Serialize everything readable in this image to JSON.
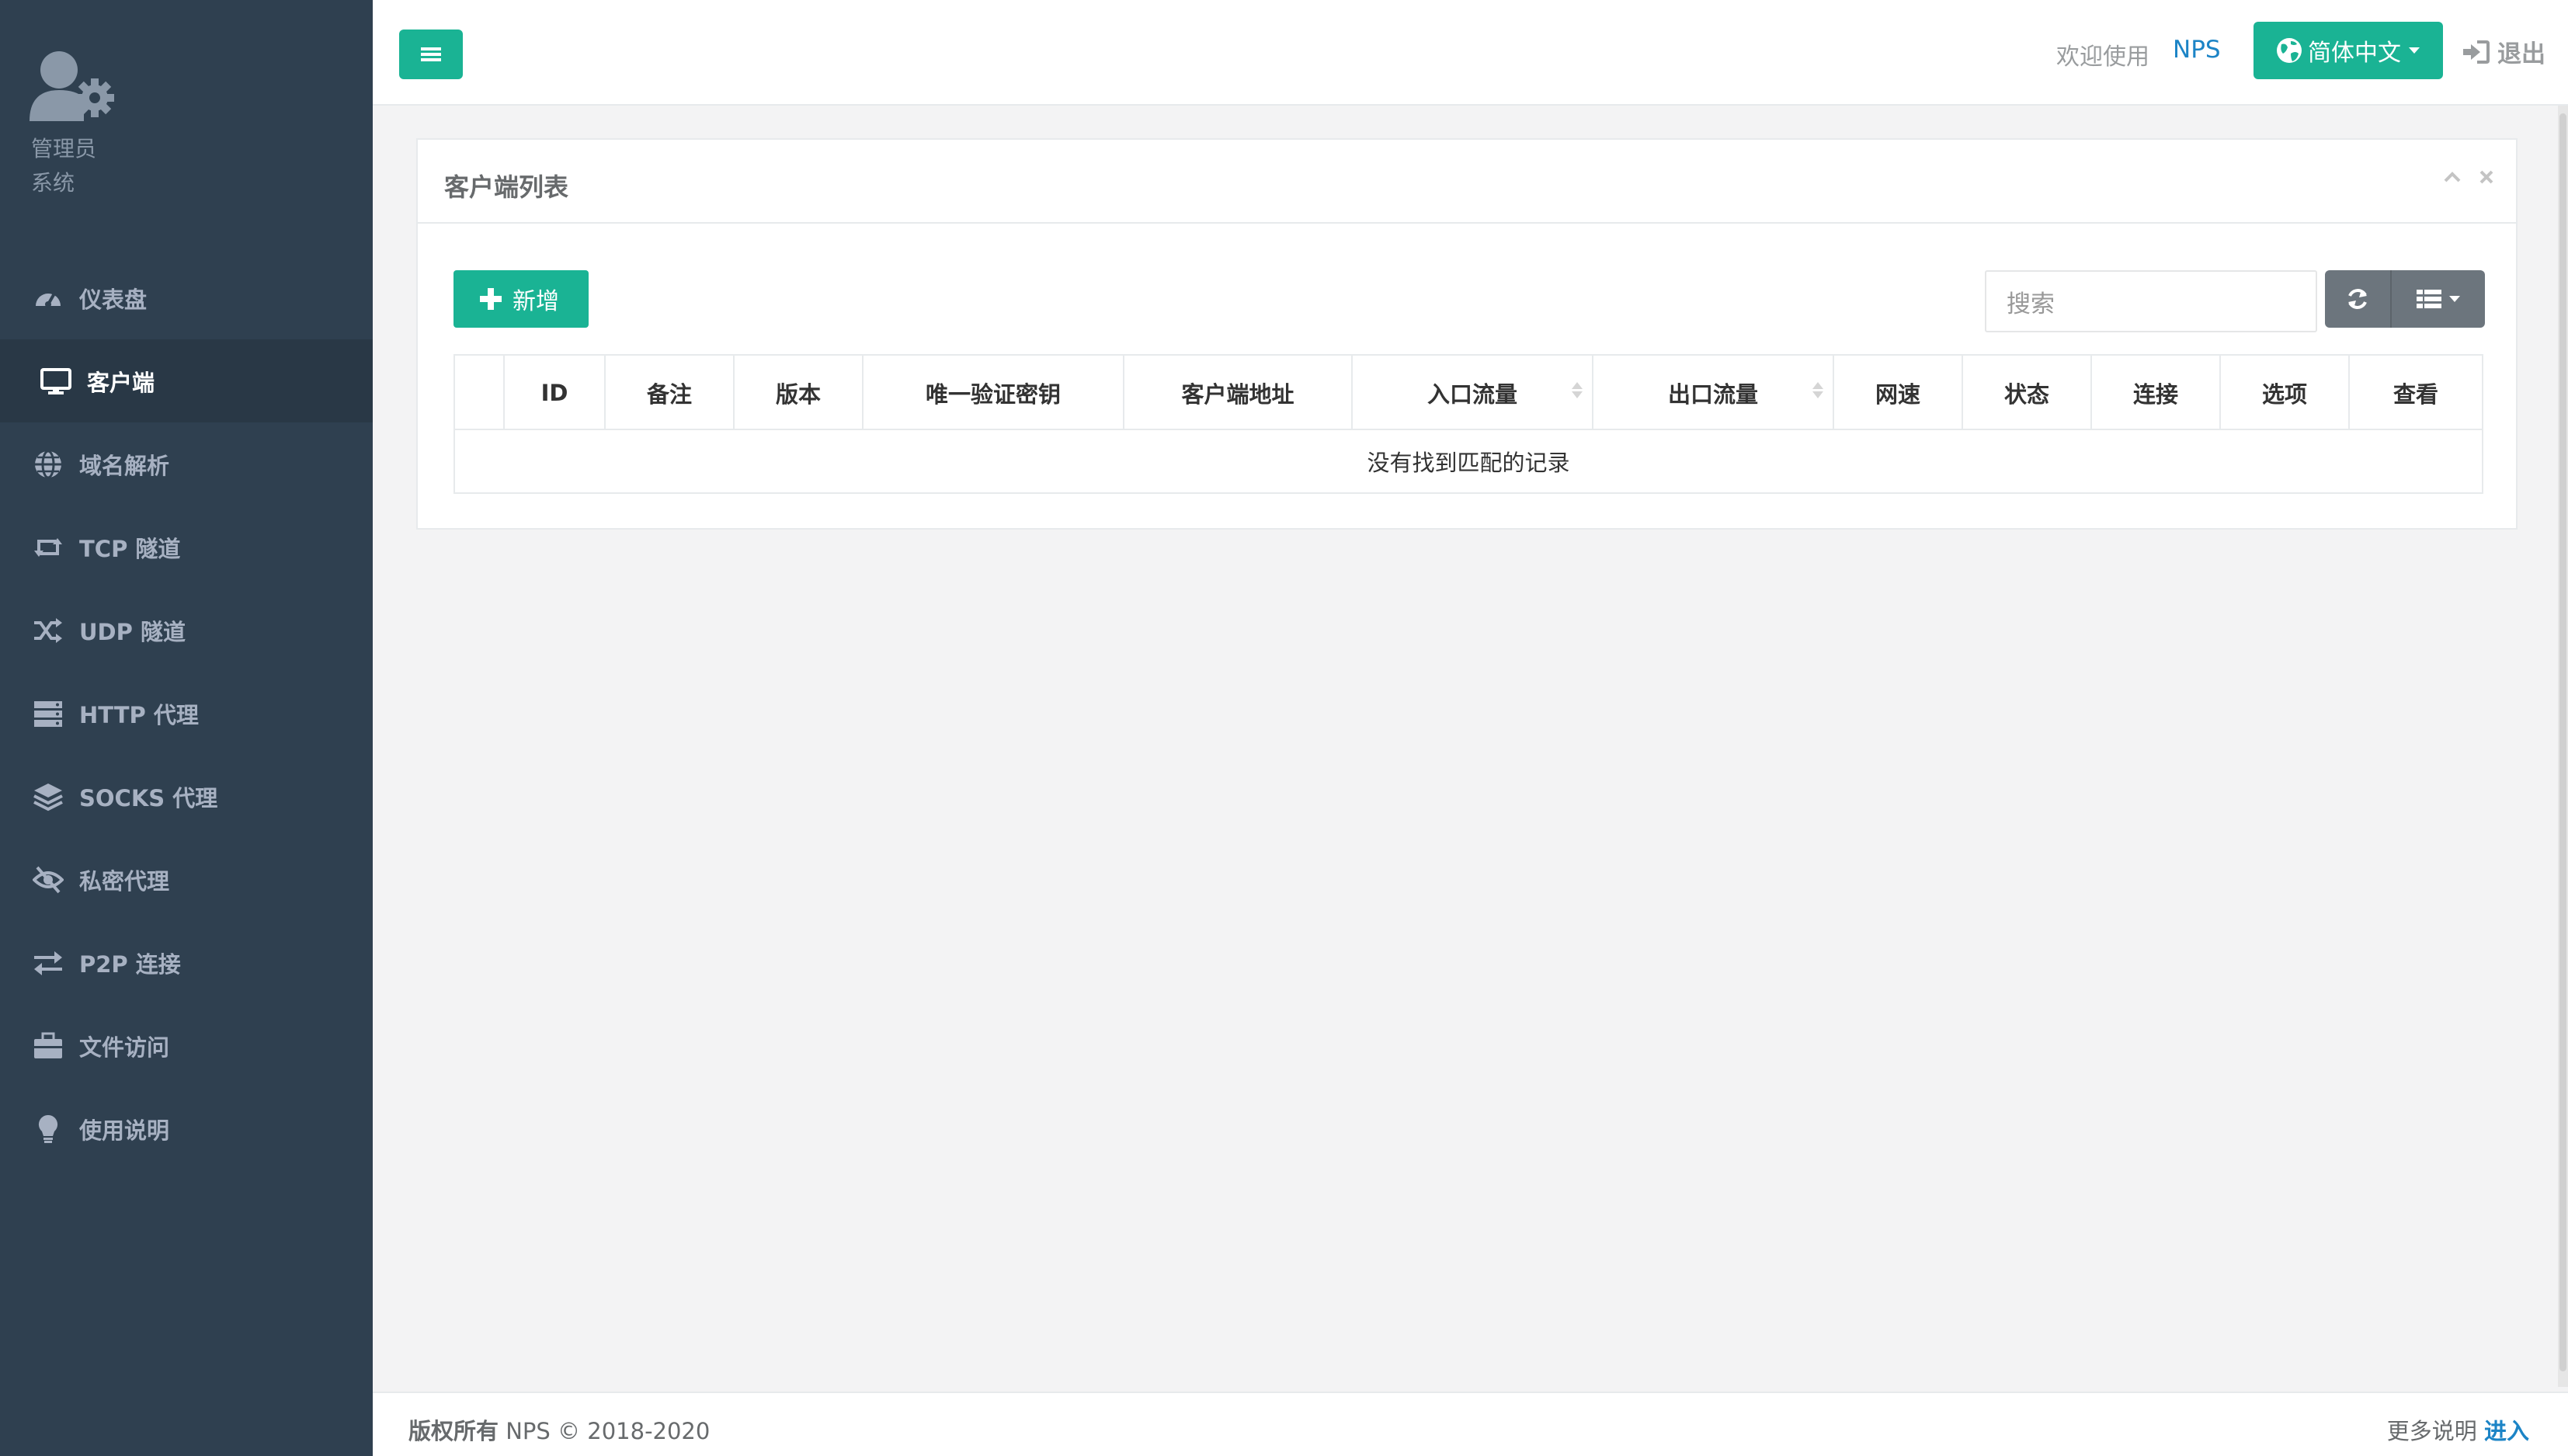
{
  "sidebar": {
    "profile_role": "管理员",
    "profile_sub": "系统",
    "items": [
      {
        "label": "仪表盘",
        "icon": "dashboard-icon"
      },
      {
        "label": "客户端",
        "icon": "desktop-icon"
      },
      {
        "label": "域名解析",
        "icon": "globe-icon"
      },
      {
        "label": "TCP 隧道",
        "icon": "retweet-icon"
      },
      {
        "label": "UDP 隧道",
        "icon": "random-icon"
      },
      {
        "label": "HTTP 代理",
        "icon": "server-icon"
      },
      {
        "label": "SOCKS 代理",
        "icon": "layers-icon"
      },
      {
        "label": "私密代理",
        "icon": "eye-slash-icon"
      },
      {
        "label": "P2P 连接",
        "icon": "exchange-icon"
      },
      {
        "label": "文件访问",
        "icon": "briefcase-icon"
      },
      {
        "label": "使用说明",
        "icon": "lightbulb-icon"
      }
    ],
    "active_index": 1
  },
  "topbar": {
    "welcome": "欢迎使用",
    "brand": "NPS",
    "language": "简体中文",
    "logout": "退出"
  },
  "panel": {
    "title": "客户端列表",
    "add_label": "新增",
    "search_placeholder": "搜索",
    "columns": [
      "",
      "ID",
      "备注",
      "版本",
      "唯一验证密钥",
      "客户端地址",
      "入口流量",
      "出口流量",
      "网速",
      "状态",
      "连接",
      "选项",
      "查看"
    ],
    "sortable": [
      "入口流量",
      "出口流量"
    ],
    "empty_message": "没有找到匹配的记录"
  },
  "footer": {
    "copyright_label": "版权所有",
    "copyright_text": "NPS © 2018-2020",
    "more_label": "更多说明",
    "enter_link": "进入"
  },
  "colors": {
    "sidebar_bg": "#2f4050",
    "sidebar_active_bg": "#293846",
    "primary": "#1ab394",
    "link": "#1c84c6",
    "page_bg": "#f3f3f4"
  }
}
